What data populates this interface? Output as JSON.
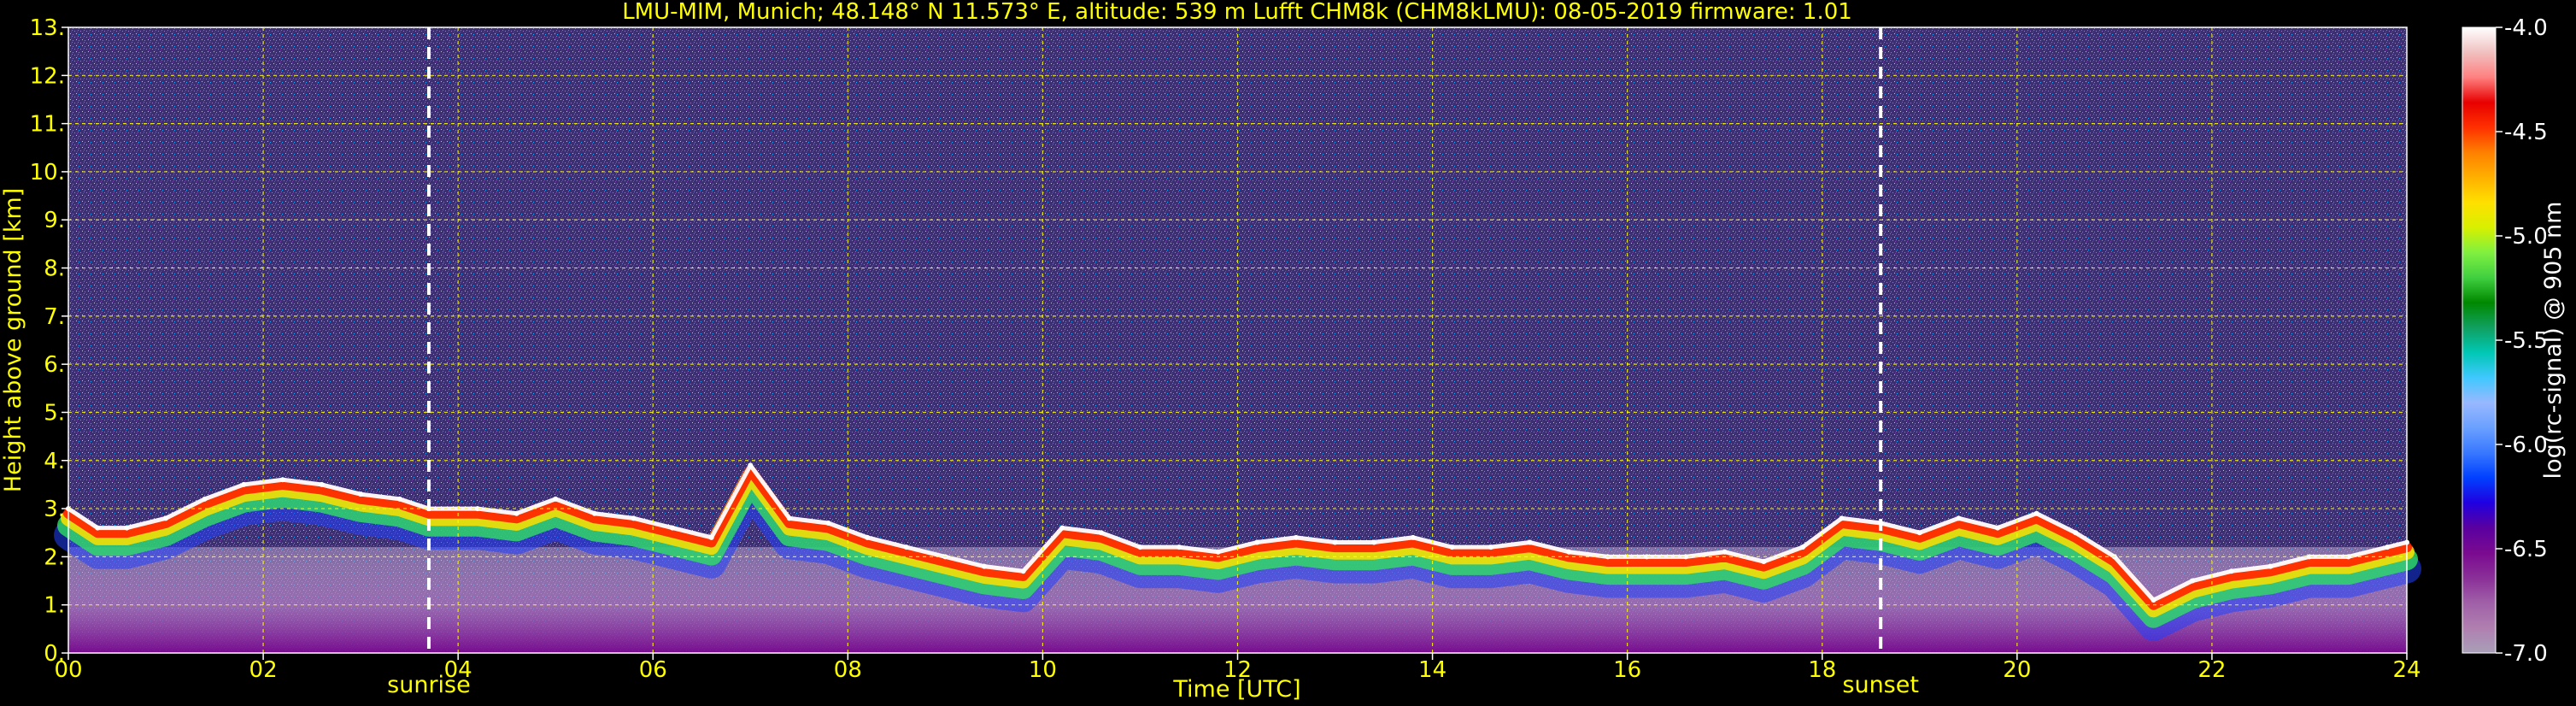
{
  "chart_data": {
    "type": "heatmap",
    "title": "LMU-MIM, Munich; 48.148° N 11.573° E, altitude: 539 m    Lufft CHM8k (CHM8kLMU): 08-05-2019    firmware: 1.01",
    "xlabel": "Time [UTC]",
    "ylabel": "Height above ground [km]",
    "xlim": [
      0,
      24
    ],
    "ylim": [
      0,
      13
    ],
    "x_tick_labels": [
      "00",
      "02",
      "04",
      "06",
      "08",
      "10",
      "12",
      "14",
      "16",
      "18",
      "20",
      "22",
      "24"
    ],
    "x_tick_values": [
      0,
      2,
      4,
      6,
      8,
      10,
      12,
      14,
      16,
      18,
      20,
      22,
      24
    ],
    "y_tick_labels": [
      "0.",
      "1.",
      "2.",
      "3.",
      "4.",
      "5.",
      "6.",
      "7.",
      "8.",
      "9.",
      "10.",
      "11.",
      "12.",
      "13."
    ],
    "y_tick_values": [
      0,
      1,
      2,
      3,
      4,
      5,
      6,
      7,
      8,
      9,
      10,
      11,
      12,
      13
    ],
    "grid": true,
    "grid_color": "#ffff00",
    "colorbar": {
      "label": "log(rc-signal) @ 905 nm",
      "range": [
        -7.0,
        -4.0
      ],
      "tick_labels": [
        "-7.0",
        "-6.5",
        "-6.0",
        "-5.5",
        "-5.0",
        "-4.5",
        "-4.0"
      ],
      "tick_values": [
        -7.0,
        -6.5,
        -6.0,
        -5.5,
        -5.0,
        -4.5,
        -4.0
      ],
      "colors": [
        "#a8a0b8",
        "#b07fb0",
        "#a060a8",
        "#8a2f98",
        "#7a0a90",
        "#5a00a0",
        "#2000e0",
        "#0040ff",
        "#3878ff",
        "#6aa0ff",
        "#98b8ff",
        "#40c8ff",
        "#00c8b4",
        "#10a060",
        "#008800",
        "#40d040",
        "#80f040",
        "#d8f000",
        "#ffe000",
        "#ffb000",
        "#ff8000",
        "#ff3000",
        "#e80000",
        "#ff8080",
        "#f0c0c0",
        "#ffffff"
      ]
    },
    "annotations": [
      {
        "label": "sunrise",
        "x": 3.7
      },
      {
        "label": "sunset",
        "x": 18.6
      }
    ],
    "series": [
      {
        "name": "",
        "x": [
          0,
          0.3,
          0.6,
          1.0,
          1.4,
          1.8,
          2.2,
          2.6,
          3.0,
          3.4,
          3.7,
          4.2,
          4.6,
          5.0,
          5.4,
          5.8,
          6.2,
          6.6,
          7.0,
          7.4,
          7.8,
          8.2,
          8.6,
          9.0,
          9.4,
          9.8,
          10.2,
          10.6,
          11.0,
          11.4,
          11.8,
          12.2,
          12.6,
          13.0,
          13.4,
          13.8,
          14.2,
          14.6,
          15.0,
          15.4,
          15.8,
          16.2,
          16.6,
          17.0,
          17.4,
          17.8,
          18.2,
          18.6,
          19.0,
          19.4,
          19.8,
          20.2,
          20.6,
          21.0,
          21.4,
          21.8,
          22.2,
          22.6,
          23.0,
          23.4,
          23.8,
          24
        ],
        "y": [
          3.0,
          2.6,
          2.6,
          2.8,
          3.2,
          3.5,
          3.6,
          3.5,
          3.3,
          3.2,
          3.0,
          3.0,
          2.9,
          3.2,
          2.9,
          2.8,
          2.6,
          2.4,
          3.9,
          2.8,
          2.7,
          2.4,
          2.2,
          2.0,
          1.8,
          1.7,
          2.6,
          2.5,
          2.2,
          2.2,
          2.1,
          2.3,
          2.4,
          2.3,
          2.3,
          2.4,
          2.2,
          2.2,
          2.3,
          2.1,
          2.0,
          2.0,
          2.0,
          2.1,
          1.9,
          2.2,
          2.8,
          2.7,
          2.5,
          2.8,
          2.6,
          2.9,
          2.5,
          2.0,
          1.1,
          1.5,
          1.7,
          1.8,
          2.0,
          2.0,
          2.2,
          2.3
        ]
      }
    ]
  }
}
